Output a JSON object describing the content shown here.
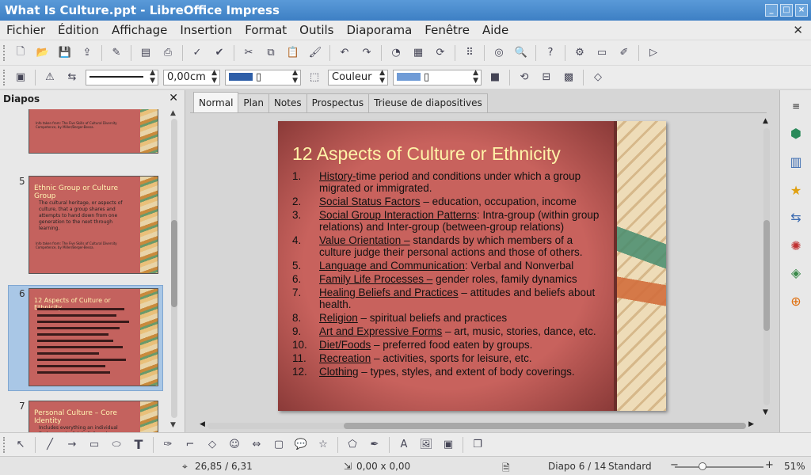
{
  "window": {
    "title": "What Is Culture.ppt - LibreOffice Impress",
    "buttons": [
      "_",
      "□",
      "×"
    ]
  },
  "menubar": {
    "items": [
      "Fichier",
      "Édition",
      "Affichage",
      "Insertion",
      "Format",
      "Outils",
      "Diaporama",
      "Fenêtre",
      "Aide"
    ]
  },
  "formatting": {
    "line_width": "0,00cm",
    "area_style": "Couleur",
    "line_color": "#2f5fa8",
    "fill_color": "#6f9bd6"
  },
  "slides_panel": {
    "title": "Diapos",
    "thumbnails": [
      {
        "number": "",
        "title": "",
        "body": "",
        "source": "Info taken from: The Five Skills of Cultural Diversity Competence, by Miller/Berger-Bessa."
      },
      {
        "number": "5",
        "title": "Ethnic Group or Culture Group",
        "body": "The cultural heritage, or aspects of culture, that a group shares and attempts to hand down from one generation to the next through learning.",
        "source": "Info taken from: The Five Skills of Cultural Diversity Competence, by Miller/Berger-Bessa."
      },
      {
        "number": "6",
        "title": "12 Aspects of Culture or Ethnicity",
        "body": "",
        "source": ""
      },
      {
        "number": "7",
        "title": "Personal Culture – Core Identity",
        "body": "Includes everything an individual finds meaningful, beliefs, values, perceptions, assumptions, and",
        "source": ""
      }
    ]
  },
  "tabs": [
    "Normal",
    "Plan",
    "Notes",
    "Prospectus",
    "Trieuse de diapositives"
  ],
  "slide": {
    "title": "12 Aspects of Culture or Ethnicity",
    "items": [
      {
        "num": "1.",
        "term": "History-",
        "rest": "time period and conditions under which a group migrated or immigrated."
      },
      {
        "num": "2.",
        "term": "Social Status Factors",
        "rest": " – education, occupation, income"
      },
      {
        "num": "3.",
        "term": "Social Group Interaction Patterns",
        "rest": ": Intra-group (within group relations) and Inter-group (between-group relations)"
      },
      {
        "num": "4.",
        "term": "Value Orientation –",
        "rest": " standards by which members of a culture judge their personal actions and those of others."
      },
      {
        "num": "5.",
        "term": "Language and Communication",
        "rest": ": Verbal and Nonverbal"
      },
      {
        "num": "6.",
        "term": "Family Life Processes –",
        "rest": " gender roles, family dynamics"
      },
      {
        "num": "7.",
        "term": "Healing Beliefs and Practices",
        "rest": " – attitudes and beliefs about health."
      },
      {
        "num": "8.",
        "term": "Religion",
        "rest": " – spiritual beliefs and practices"
      },
      {
        "num": "9.",
        "term": "Art and Expressive Forms",
        "rest": " – art, music, stories, dance, etc."
      },
      {
        "num": "10.",
        "term": "Diet/Foods",
        "rest": " – preferred food eaten by groups."
      },
      {
        "num": "11.",
        "term": "Recreation",
        "rest": " – activities, sports for leisure, etc."
      },
      {
        "num": "12.",
        "term": "Clothing",
        "rest": " – types, styles, and extent of body coverings."
      }
    ]
  },
  "status": {
    "position": "26,85 / 6,31",
    "size": "0,00 x 0,00",
    "slide": "Diapo 6 / 14",
    "master": "Standard",
    "zoom": "51%",
    "zoom_minus": "−",
    "zoom_plus": "+"
  }
}
